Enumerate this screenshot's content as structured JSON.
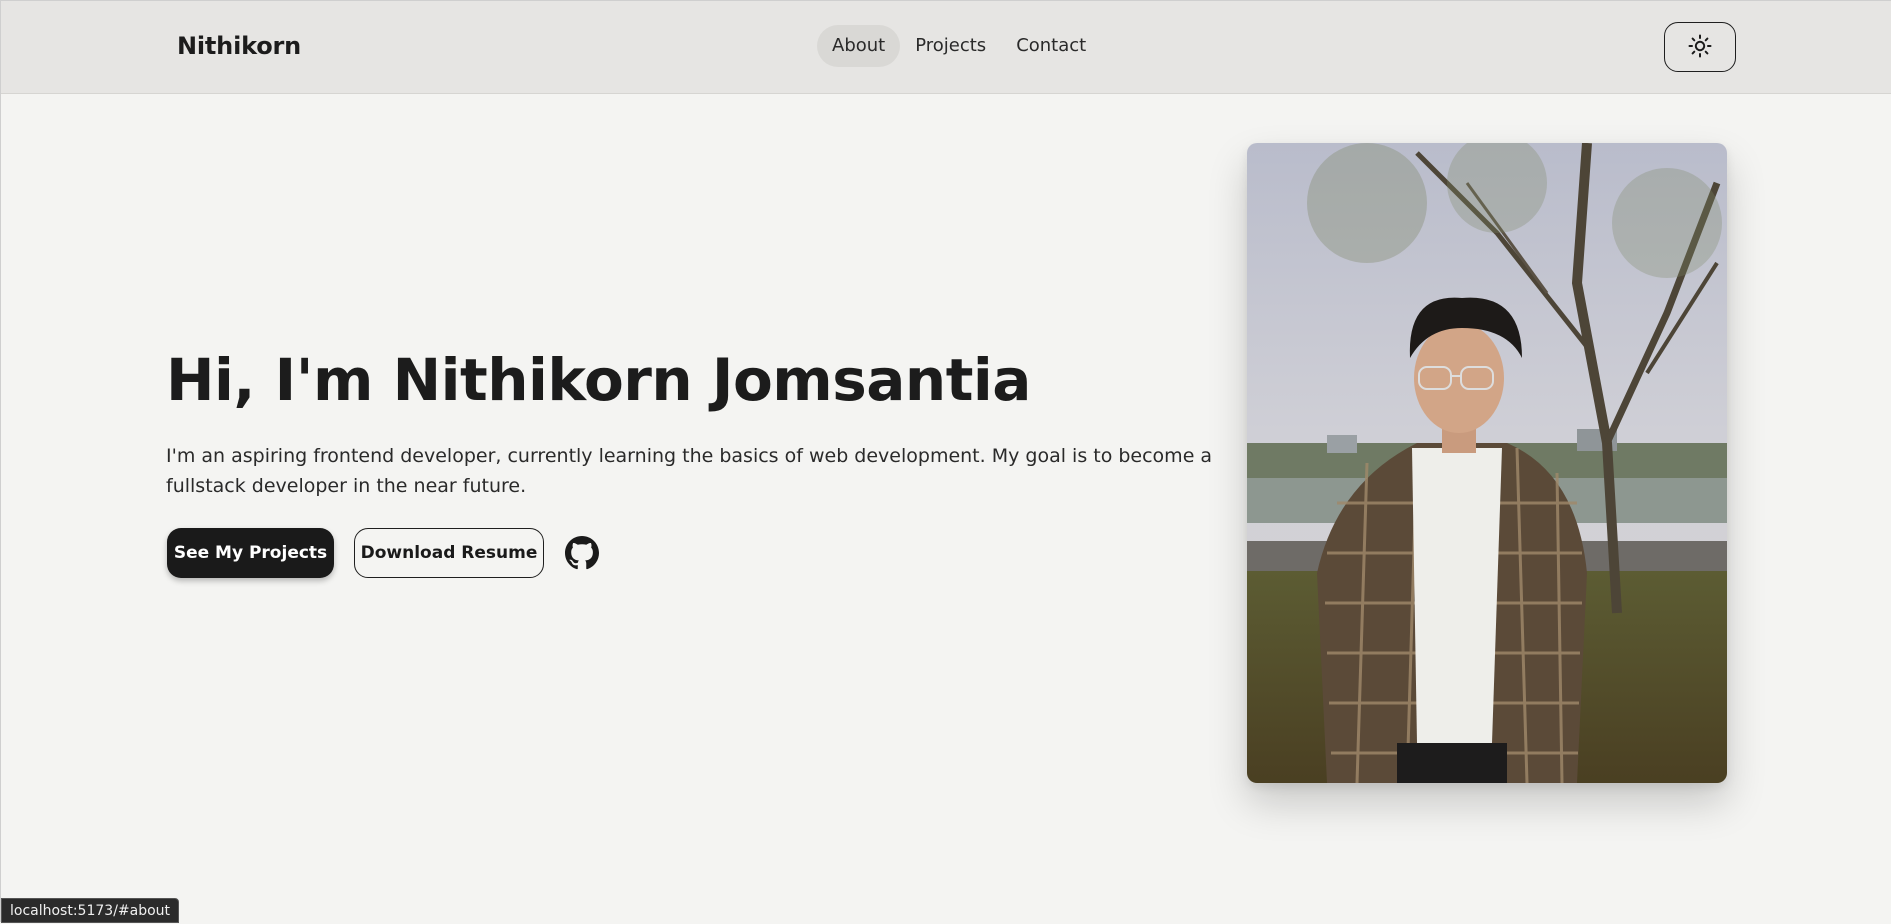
{
  "header": {
    "brand": "Nithikorn",
    "nav": [
      {
        "label": "About",
        "active": true
      },
      {
        "label": "Projects",
        "active": false
      },
      {
        "label": "Contact",
        "active": false
      }
    ],
    "theme_toggle_icon": "sun-icon"
  },
  "hero": {
    "title": "Hi, I'm Nithikorn Jomsantia",
    "description": "I'm an aspiring frontend developer, currently learning the basics of web development. My goal is to become a fullstack developer in the near future.",
    "primary_button": "See My Projects",
    "secondary_button": "Download Resume",
    "github_icon": "github-icon"
  },
  "photo": {
    "subject": "profile-photo"
  },
  "status_bar": {
    "url": "localhost:5173/#about"
  },
  "colors": {
    "header_bg": "#e6e5e3",
    "page_bg": "#f4f4f2",
    "text": "#1a1a1a",
    "primary_button_bg": "#1a1a1a",
    "active_nav_bg": "#d9d8d5"
  }
}
